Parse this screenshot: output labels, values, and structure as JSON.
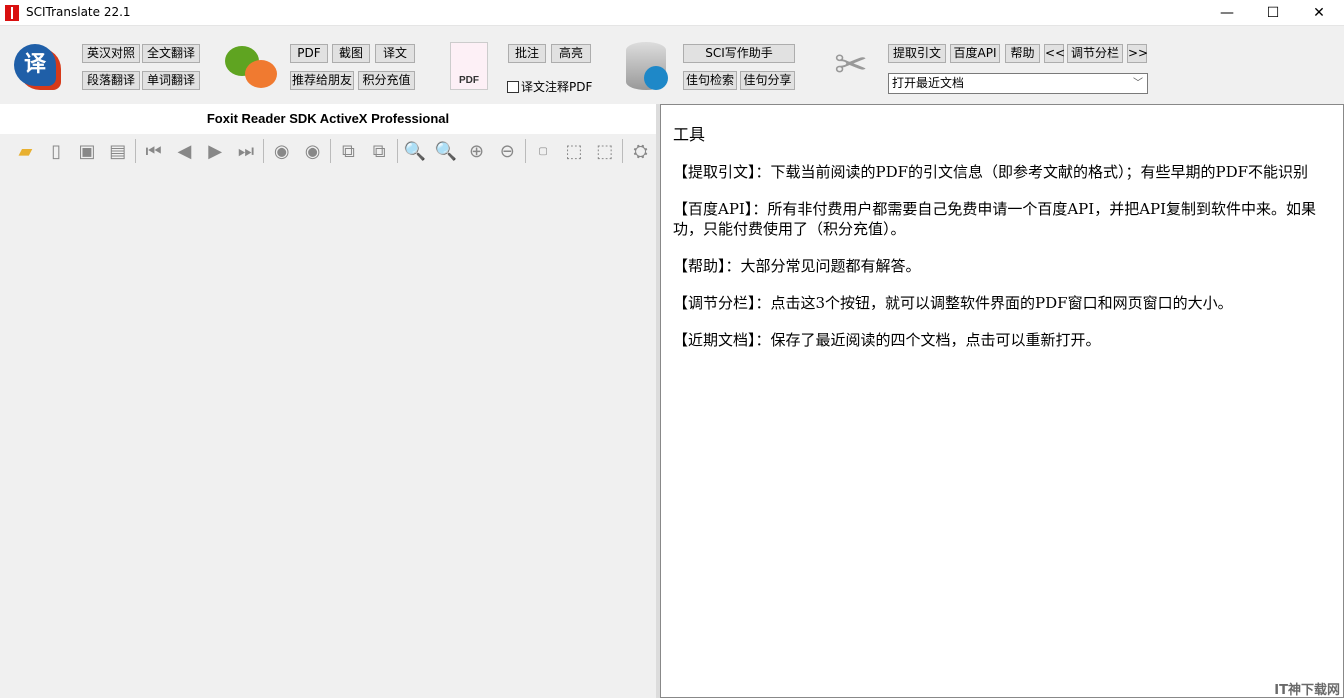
{
  "window": {
    "title": "SCITranslate 22.1",
    "minimize": "—",
    "maximize": "☐",
    "close": "✕"
  },
  "toolbar": {
    "group1": [
      "英汉对照",
      "全文翻译",
      "段落翻译",
      "单词翻译"
    ],
    "group2": [
      "PDF",
      "截图",
      "译文",
      "推荐给朋友",
      "积分充值"
    ],
    "group3": [
      "批注",
      "高亮"
    ],
    "pdf_icon_label": "PDF",
    "checkbox_label": "译文注释PDF",
    "group4": [
      "SCI写作助手",
      "佳句检索",
      "佳句分享"
    ],
    "group5": [
      "提取引文",
      "百度API",
      "帮助",
      "<<",
      "调节分栏",
      ">>"
    ],
    "recent_docs": "打开最近文档",
    "translate_icon_glyph": "译"
  },
  "left_panel": {
    "title": "Foxit Reader SDK ActiveX Professional"
  },
  "right_panel": {
    "heading": "工具",
    "paragraphs": [
      "【提取引文】：下载当前阅读的PDF的引文信息（即参考文献的格式）；有些早期的PDF不能识别",
      "【百度API】：所有非付费用户都需要自己免费申请一个百度API，并把API复制到软件中来。如果",
      "功，只能付费使用了（积分充值）。",
      "【帮助】：大部分常见问题都有解答。",
      "【调节分栏】：点击这3个按钮，就可以调整软件界面的PDF窗口和网页窗口的大小。",
      "【近期文档】：保存了最近阅读的四个文档，点击可以重新打开。"
    ]
  },
  "watermark": "IT神下载网"
}
